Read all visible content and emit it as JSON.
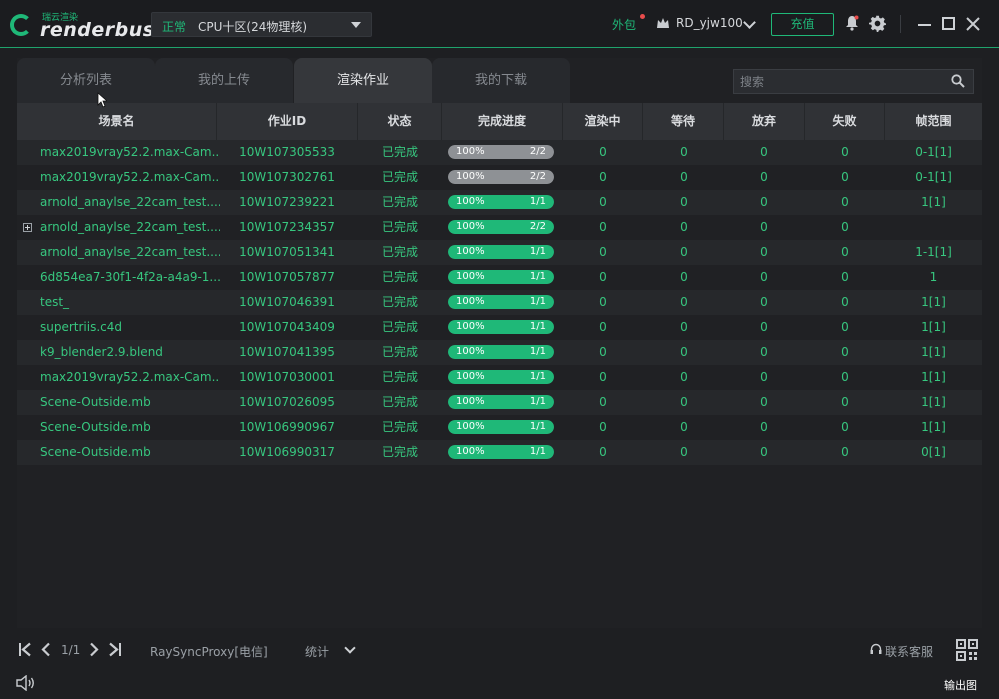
{
  "app": {
    "logo_sub": "瑞云渲染",
    "logo_name": "renderbus"
  },
  "region": {
    "status": "正常",
    "name": "CPU十区(24物理核)"
  },
  "header": {
    "external_label": "外包",
    "user_name": "RD_yjw100",
    "recharge_label": "充值"
  },
  "tabs": [
    {
      "label": "分析列表",
      "active": false
    },
    {
      "label": "我的上传",
      "active": false
    },
    {
      "label": "渲染作业",
      "active": true
    },
    {
      "label": "我的下载",
      "active": false
    }
  ],
  "search": {
    "placeholder": "搜索"
  },
  "columns": [
    "场景名",
    "作业ID",
    "状态",
    "完成进度",
    "渲染中",
    "等待",
    "放弃",
    "失败",
    "帧范围"
  ],
  "rows": [
    {
      "scene": "max2019vray52.2.max-Cam...",
      "id": "10W107305533",
      "status": "已完成",
      "pct": "100%",
      "frac": "2/2",
      "progress": 1.0,
      "bar_color": "#8e9195",
      "rendering": "0",
      "waiting": "0",
      "abandoned": "0",
      "failed": "0",
      "frames": "0-1[1]",
      "expand": false
    },
    {
      "scene": "max2019vray52.2.max-Cam...",
      "id": "10W107302761",
      "status": "已完成",
      "pct": "100%",
      "frac": "2/2",
      "progress": 1.0,
      "bar_color": "#8e9195",
      "rendering": "0",
      "waiting": "0",
      "abandoned": "0",
      "failed": "0",
      "frames": "0-1[1]",
      "expand": false
    },
    {
      "scene": "arnold_anaylse_22cam_test....",
      "id": "10W107239221",
      "status": "已完成",
      "pct": "100%",
      "frac": "1/1",
      "progress": 1.0,
      "bar_color": "#1fb878",
      "rendering": "0",
      "waiting": "0",
      "abandoned": "0",
      "failed": "0",
      "frames": "1[1]",
      "expand": false
    },
    {
      "scene": "arnold_anaylse_22cam_test....",
      "id": "10W107234357",
      "status": "已完成",
      "pct": "100%",
      "frac": "2/2",
      "progress": 1.0,
      "bar_color": "#1fb878",
      "rendering": "0",
      "waiting": "0",
      "abandoned": "0",
      "failed": "0",
      "frames": "",
      "expand": true
    },
    {
      "scene": "arnold_anaylse_22cam_test....",
      "id": "10W107051341",
      "status": "已完成",
      "pct": "100%",
      "frac": "1/1",
      "progress": 1.0,
      "bar_color": "#1fb878",
      "rendering": "0",
      "waiting": "0",
      "abandoned": "0",
      "failed": "0",
      "frames": "1-1[1]",
      "expand": false
    },
    {
      "scene": "6d854ea7-30f1-4f2a-a4a9-1...",
      "id": "10W107057877",
      "status": "已完成",
      "pct": "100%",
      "frac": "1/1",
      "progress": 1.0,
      "bar_color": "#1fb878",
      "rendering": "0",
      "waiting": "0",
      "abandoned": "0",
      "failed": "0",
      "frames": "1",
      "expand": false
    },
    {
      "scene": "test_",
      "id": "10W107046391",
      "status": "已完成",
      "pct": "100%",
      "frac": "1/1",
      "progress": 1.0,
      "bar_color": "#1fb878",
      "rendering": "0",
      "waiting": "0",
      "abandoned": "0",
      "failed": "0",
      "frames": "1[1]",
      "expand": false
    },
    {
      "scene": "supertriis.c4d",
      "id": "10W107043409",
      "status": "已完成",
      "pct": "100%",
      "frac": "1/1",
      "progress": 1.0,
      "bar_color": "#1fb878",
      "rendering": "0",
      "waiting": "0",
      "abandoned": "0",
      "failed": "0",
      "frames": "1[1]",
      "expand": false
    },
    {
      "scene": "k9_blender2.9.blend",
      "id": "10W107041395",
      "status": "已完成",
      "pct": "100%",
      "frac": "1/1",
      "progress": 1.0,
      "bar_color": "#1fb878",
      "rendering": "0",
      "waiting": "0",
      "abandoned": "0",
      "failed": "0",
      "frames": "1[1]",
      "expand": false
    },
    {
      "scene": "max2019vray52.2.max-Cam...",
      "id": "10W107030001",
      "status": "已完成",
      "pct": "100%",
      "frac": "1/1",
      "progress": 1.0,
      "bar_color": "#1fb878",
      "rendering": "0",
      "waiting": "0",
      "abandoned": "0",
      "failed": "0",
      "frames": "1[1]",
      "expand": false
    },
    {
      "scene": "Scene-Outside.mb",
      "id": "10W107026095",
      "status": "已完成",
      "pct": "100%",
      "frac": "1/1",
      "progress": 1.0,
      "bar_color": "#1fb878",
      "rendering": "0",
      "waiting": "0",
      "abandoned": "0",
      "failed": "0",
      "frames": "1[1]",
      "expand": false
    },
    {
      "scene": "Scene-Outside.mb",
      "id": "10W106990967",
      "status": "已完成",
      "pct": "100%",
      "frac": "1/1",
      "progress": 1.0,
      "bar_color": "#1fb878",
      "rendering": "0",
      "waiting": "0",
      "abandoned": "0",
      "failed": "0",
      "frames": "1[1]",
      "expand": false
    },
    {
      "scene": "Scene-Outside.mb",
      "id": "10W106990317",
      "status": "已完成",
      "pct": "100%",
      "frac": "1/1",
      "progress": 1.0,
      "bar_color": "#1fb878",
      "rendering": "0",
      "waiting": "0",
      "abandoned": "0",
      "failed": "0",
      "frames": "0[1]",
      "expand": false
    }
  ],
  "footer": {
    "page_info": "1/1",
    "proxy": "RaySyncProxy[电信]",
    "stats_label": "统计",
    "support_label": "联系客服",
    "output_label": "输出图"
  },
  "icons": {
    "avatar": "avatar-icon",
    "bell": "bell-icon",
    "settings": "gear-icon",
    "search": "search-icon",
    "qr": "qr-code-icon",
    "sound": "speaker-icon",
    "support": "headset-icon"
  },
  "colors": {
    "accent": "#1fb878",
    "text_green": "#37c77f",
    "background": "#1e1f22",
    "bar_gray": "#8e9195",
    "alert": "#e84c4c"
  }
}
